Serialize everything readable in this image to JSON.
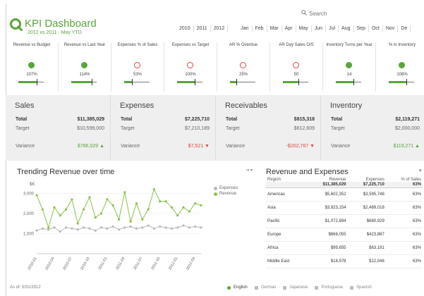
{
  "header": {
    "title": "KPI Dashboard",
    "subtitle": "2012 vs 2011 · May YTD",
    "search_placeholder": "Search",
    "years": [
      "2010",
      "2011",
      "2012"
    ],
    "months": [
      "Jan",
      "Feb",
      "Mar",
      "Apr",
      "May",
      "Jun",
      "Jul",
      "Aug",
      "Sep",
      "Oct",
      "Nov",
      "De"
    ]
  },
  "kpis": [
    {
      "label": "Revenue vs Budget",
      "value": "107%",
      "status": "good",
      "fill": 0.72
    },
    {
      "label": "Revenue vs Last Year",
      "value": "114%",
      "status": "good",
      "fill": 0.8
    },
    {
      "label": "Expenses % of Sales",
      "value": "53%",
      "status": "bad",
      "fill": 0.3
    },
    {
      "label": "Expenses vs Target",
      "value": "100%",
      "status": "bad",
      "fill": 0.7
    },
    {
      "label": "AR % Overdue",
      "value": "25%",
      "status": "bad",
      "fill": 0.25
    },
    {
      "label": "AR Day Sales O/S",
      "value": "50",
      "status": "bad",
      "fill": 0.62
    },
    {
      "label": "Inventory Turns per Year",
      "value": "14",
      "status": "good",
      "fill": 0.7
    },
    {
      "label": "% in Inventory",
      "value": "108%",
      "status": "good",
      "fill": 0.7
    }
  ],
  "summary": [
    {
      "title": "Sales",
      "total_label": "Total",
      "total": "$11,385,029",
      "target_label": "Target",
      "target": "$10,599,000",
      "variance_label": "Variance",
      "variance": "$786,029 ▲",
      "variance_status": "good"
    },
    {
      "title": "Expenses",
      "total_label": "Total",
      "total": "$7,225,710",
      "target_label": "Target",
      "target": "$7,210,189",
      "variance_label": "Variance",
      "variance": "$7,521 ▼",
      "variance_status": "bad"
    },
    {
      "title": "Receivables",
      "total_label": "Total",
      "total": "$815,318",
      "target_label": "Target",
      "target": "$612,609",
      "variance_label": "Variance",
      "variance": "-$202,767 ▼",
      "variance_status": "bad"
    },
    {
      "title": "Inventory",
      "total_label": "Total",
      "total": "$2,119,271",
      "target_label": "Target",
      "target": "$2,000,000",
      "variance_label": "Variance",
      "variance": "$119,271 ▲",
      "variance_status": "good"
    }
  ],
  "trend": {
    "title": "Trending Revenue over time",
    "tools": "⇥ ▾"
  },
  "chart_data": {
    "type": "line",
    "title": "Trending Revenue over time",
    "ylabel": "$K",
    "ylim": [
      0,
      3500
    ],
    "yticks": [
      "1,000",
      "2,000",
      "3,000"
    ],
    "x": [
      "2010-01",
      "2010-02",
      "2010-03",
      "2010-04",
      "2010-05",
      "2010-06",
      "2010-07",
      "2010-08",
      "2010-09",
      "2010-10",
      "2010-11",
      "2010-12",
      "2011-01",
      "2011-02",
      "2011-03",
      "2011-04",
      "2011-05",
      "2011-06",
      "2011-07",
      "2011-08",
      "2011-09",
      "2011-10",
      "2011-11",
      "2011-12",
      "2012-01",
      "2012-02",
      "2012-03",
      "2012-04",
      "2012-05"
    ],
    "xtick_labels": [
      "2010-01",
      "2010-04",
      "2010-07",
      "2010-10",
      "2011-01",
      "2011-04",
      "2011-07",
      "2011-10",
      "2012-01",
      "2012-04"
    ],
    "series": [
      {
        "name": "Expenses",
        "color": "#b9b9b9",
        "values": [
          1150,
          1250,
          1200,
          1300,
          1100,
          1300,
          1250,
          1200,
          1300,
          1250,
          1150,
          1300,
          1250,
          1350,
          1200,
          1300,
          1350,
          1250,
          1300,
          1400,
          1250,
          1350,
          1300,
          1250,
          1300,
          1400,
          1300,
          1350,
          1300
        ]
      },
      {
        "name": "Revenue",
        "color": "#8bc34a",
        "values": [
          2900,
          2200,
          1300,
          2300,
          1900,
          2200,
          2700,
          1500,
          2200,
          2800,
          1800,
          2000,
          2700,
          2400,
          1700,
          3050,
          1600,
          2500,
          1700,
          2200,
          3200,
          2600,
          2600,
          2300,
          1900,
          2300,
          2100,
          2500,
          2400
        ]
      }
    ]
  },
  "rev_exp": {
    "title": "Revenue and Expenses",
    "columns": [
      "Region",
      "Revenue",
      "Expenses",
      "% of Sales"
    ],
    "total": [
      "",
      "$11,385,029",
      "$7,225,710",
      "63%"
    ],
    "rows": [
      [
        "Americas",
        "$5,602,352",
        "$3,595,748",
        "63%"
      ],
      [
        "Asia",
        "$3,923,154",
        "$2,489,018",
        "63%"
      ],
      [
        "Pacific",
        "$1,072,894",
        "$680,929",
        "63%"
      ],
      [
        "Europe",
        "$668,055",
        "$423,887",
        "63%"
      ],
      [
        "Africa",
        "$99,655",
        "$63,191",
        "63%"
      ],
      [
        "Middle East",
        "$18,978",
        "$12,046",
        "63%"
      ]
    ]
  },
  "footer": {
    "as_of": "As of: 5/31/2012",
    "languages": [
      {
        "label": "English",
        "active": true
      },
      {
        "label": "German",
        "active": false
      },
      {
        "label": "Japanese",
        "active": false
      },
      {
        "label": "Portuguese",
        "active": false
      },
      {
        "label": "Spanish",
        "active": false
      }
    ]
  },
  "colors": {
    "accent": "#5aa43a",
    "bad": "#e34242",
    "panel": "#efefef"
  }
}
